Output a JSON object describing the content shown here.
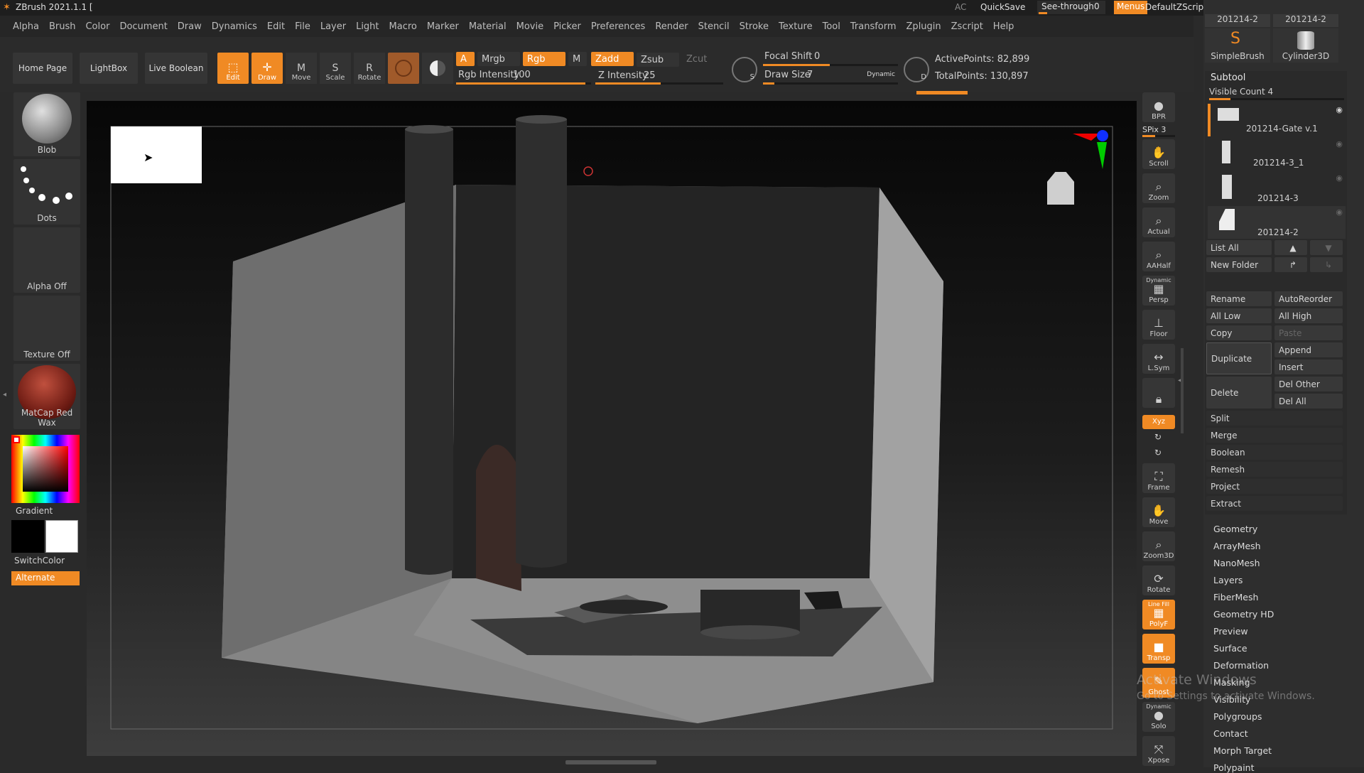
{
  "title": "ZBrush 2021.1.1 [",
  "titlebar": {
    "ac": "AC",
    "quicksave": "QuickSave",
    "seethrough_label": "See-through",
    "seethrough_value": "0",
    "menus": "Menus",
    "script": "DefaultZScript"
  },
  "menu": [
    "Alpha",
    "Brush",
    "Color",
    "Document",
    "Draw",
    "Dynamics",
    "Edit",
    "File",
    "Layer",
    "Light",
    "Macro",
    "Marker",
    "Material",
    "Movie",
    "Picker",
    "Preferences",
    "Render",
    "Stencil",
    "Stroke",
    "Texture",
    "Tool",
    "Transform",
    "Zplugin",
    "Zscript",
    "Help"
  ],
  "toolbar": {
    "home": "Home Page",
    "lightbox": "LightBox",
    "liveboolean": "Live Boolean",
    "edit": "Edit",
    "draw": "Draw",
    "move": "Move",
    "scale": "Scale",
    "rotate": "Rotate",
    "a": "A",
    "mrgb": "Mrgb",
    "rgb": "Rgb",
    "m": "M",
    "zadd": "Zadd",
    "zsub": "Zsub",
    "zcut": "Zcut",
    "rgb_intensity_label": "Rgb Intensity",
    "rgb_intensity": "100",
    "z_intensity_label": "Z Intensity",
    "z_intensity": "25",
    "focal_label": "Focal Shift",
    "focal": "0",
    "drawsize_label": "Draw Size",
    "drawsize": "7",
    "dynamic": "Dynamic",
    "active_points": "ActivePoints: 82,899",
    "total_points": "TotalPoints: 130,897",
    "s": "S",
    "d": "D"
  },
  "left": {
    "blob": "Blob",
    "dots": "Dots",
    "alpha": "Alpha Off",
    "texture": "Texture Off",
    "matcap": "MatCap Red Wax",
    "gradient": "Gradient",
    "switchcolor": "SwitchColor",
    "alternate": "Alternate"
  },
  "right_shelf": [
    {
      "label": "BPR",
      "icon": "render-icon"
    },
    {
      "label": "Scroll",
      "icon": "scroll-icon"
    },
    {
      "label": "Zoom",
      "icon": "zoom-icon"
    },
    {
      "label": "Actual",
      "icon": "actual-icon"
    },
    {
      "label": "AAHalf",
      "icon": "aahalf-icon"
    },
    {
      "label": "Persp",
      "icon": "persp-icon"
    },
    {
      "label": "Floor",
      "icon": "floor-icon"
    },
    {
      "label": "L.Sym",
      "icon": "lsym-icon"
    },
    {
      "label": "",
      "icon": "lock-icon"
    },
    {
      "label": "Xyz",
      "icon": "xyz-icon"
    },
    {
      "label": "Frame",
      "icon": "frame-icon"
    },
    {
      "label": "Move",
      "icon": "move-icon"
    },
    {
      "label": "Zoom3D",
      "icon": "zoom3d-icon"
    },
    {
      "label": "Rotate",
      "icon": "rotate-icon"
    },
    {
      "label": "PolyF",
      "icon": "polyf-icon"
    },
    {
      "label": "Transp",
      "icon": "transp-icon"
    },
    {
      "label": "Ghost",
      "icon": "ghost-icon"
    },
    {
      "label": "Solo",
      "icon": "solo-icon"
    },
    {
      "label": "Xpose",
      "icon": "xpose-icon"
    }
  ],
  "right_shelf_extra": {
    "spix": "SPix 3",
    "dynamic": "Dynamic",
    "linefill": "Line Fill"
  },
  "panel": {
    "tool_a": "201214-2",
    "tool_b": "201214-2",
    "simplebrush": "SimpleBrush",
    "cylinder": "Cylinder3D",
    "subtool": "Subtool",
    "visible_count": "Visible Count 4",
    "subtools": [
      "201214-Gate v.1",
      "201214-3_1",
      "201214-3",
      "201214-2"
    ],
    "listall": "List All",
    "newfolder": "New Folder",
    "rename": "Rename",
    "autoreorder": "AutoReorder",
    "alllow": "All Low",
    "allhigh": "All High",
    "copy": "Copy",
    "paste": "Paste",
    "duplicate": "Duplicate",
    "append": "Append",
    "insert": "Insert",
    "delete": "Delete",
    "delother": "Del Other",
    "delall": "Del All",
    "actions": [
      "Split",
      "Merge",
      "Boolean",
      "Remesh",
      "Project",
      "Extract"
    ],
    "sections": [
      "Geometry",
      "ArrayMesh",
      "NanoMesh",
      "Layers",
      "FiberMesh",
      "Geometry HD",
      "Preview",
      "Surface",
      "Deformation",
      "Masking",
      "Visibility",
      "Polygroups",
      "Contact",
      "Morph Target",
      "Polypaint"
    ]
  },
  "watermark": {
    "line1": "Activate Windows",
    "line2": "Go to Settings to activate Windows."
  },
  "colors": {
    "accent": "#f08a24",
    "bg": "#2a2a2a"
  }
}
